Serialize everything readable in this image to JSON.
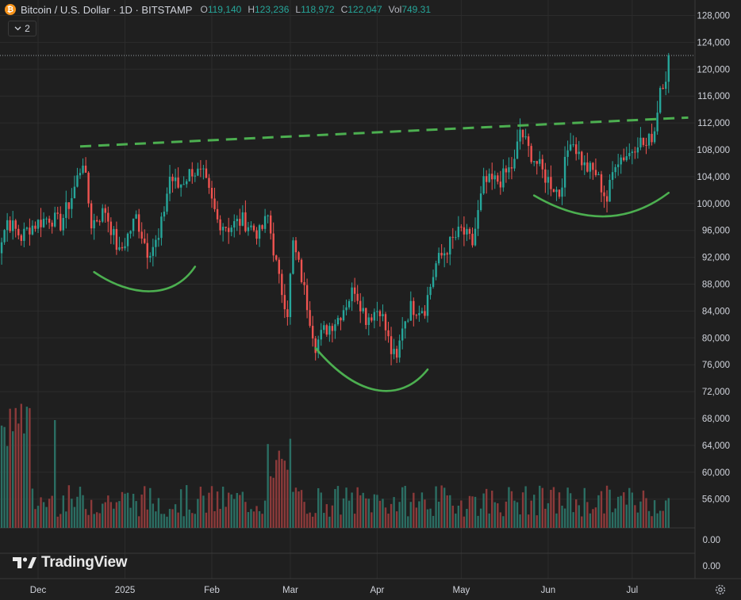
{
  "header": {
    "coin_glyph": "₿",
    "symbol": "Bitcoin / U.S. Dollar · 1D · BITSTAMP",
    "ohlc": [
      {
        "k": "O",
        "v": "119,140"
      },
      {
        "k": "H",
        "v": "123,236"
      },
      {
        "k": "L",
        "v": "118,972"
      },
      {
        "k": "C",
        "v": "122,047"
      },
      {
        "k": "Vol",
        "v": "749.31"
      }
    ]
  },
  "indicator_count": "2",
  "brand": "TradingView",
  "colors": {
    "up": "#26a69a",
    "down": "#ef5350",
    "vol_up": "#2b6e63",
    "vol_down": "#8b3a3a",
    "annotation": "#4caf50",
    "background": "#1f1f1f",
    "grid": "#2c2c2c",
    "axis_text": "#d1d4dc"
  },
  "chart_data": {
    "type": "candlestick",
    "x_axis": {
      "ticks": [
        {
          "date": "2024-12-01",
          "label": "Dec"
        },
        {
          "date": "2025-01-01",
          "label": "2025"
        },
        {
          "date": "2025-02-01",
          "label": "Feb"
        },
        {
          "date": "2025-03-01",
          "label": "Mar"
        },
        {
          "date": "2025-04-01",
          "label": "Apr"
        },
        {
          "date": "2025-05-01",
          "label": "May"
        },
        {
          "date": "2025-06-01",
          "label": "Jun"
        },
        {
          "date": "2025-07-01",
          "label": "Jul"
        }
      ]
    },
    "y_axis": {
      "range": [
        52000,
        130000
      ],
      "ticks": [
        "128,000",
        "124,000",
        "120,000",
        "116,000",
        "112,000",
        "108,000",
        "104,000",
        "100,000",
        "96,000",
        "92,000",
        "88,000",
        "84,000",
        "80,000",
        "76,000",
        "72,000",
        "68,000",
        "64,000",
        "60,000",
        "56,000"
      ],
      "tick_values": [
        128000,
        124000,
        120000,
        116000,
        112000,
        108000,
        104000,
        100000,
        96000,
        92000,
        88000,
        84000,
        80000,
        76000,
        72000,
        68000,
        64000,
        60000,
        56000
      ],
      "lower_pane_ticks": [
        "0.00",
        "0.00"
      ]
    },
    "last_price_line": 122047,
    "price_waypoints": [
      [
        "2024-11-15",
        91000
      ],
      [
        "2024-11-20",
        97500
      ],
      [
        "2024-11-25",
        95000
      ],
      [
        "2024-11-28",
        96500
      ],
      [
        "2024-12-05",
        98000
      ],
      [
        "2024-12-09",
        97000
      ],
      [
        "2024-12-13",
        101000
      ],
      [
        "2024-12-17",
        106500
      ],
      [
        "2024-12-20",
        97000
      ],
      [
        "2024-12-25",
        99000
      ],
      [
        "2024-12-30",
        92500
      ],
      [
        "2025-01-05",
        98000
      ],
      [
        "2025-01-09",
        93000
      ],
      [
        "2025-01-13",
        94500
      ],
      [
        "2025-01-17",
        104000
      ],
      [
        "2025-01-20",
        102500
      ],
      [
        "2025-01-25",
        105000
      ],
      [
        "2025-01-29",
        104000
      ],
      [
        "2025-02-03",
        97500
      ],
      [
        "2025-02-07",
        96500
      ],
      [
        "2025-02-12",
        97500
      ],
      [
        "2025-02-18",
        95500
      ],
      [
        "2025-02-21",
        98000
      ],
      [
        "2025-02-25",
        88500
      ],
      [
        "2025-02-28",
        84000
      ],
      [
        "2025-03-02",
        94000
      ],
      [
        "2025-03-05",
        89000
      ],
      [
        "2025-03-10",
        79000
      ],
      [
        "2025-03-13",
        81000
      ],
      [
        "2025-03-18",
        83000
      ],
      [
        "2025-03-24",
        87500
      ],
      [
        "2025-03-28",
        83000
      ],
      [
        "2025-04-02",
        84500
      ],
      [
        "2025-04-06",
        78000
      ],
      [
        "2025-04-08",
        76500
      ],
      [
        "2025-04-10",
        82000
      ],
      [
        "2025-04-13",
        84500
      ],
      [
        "2025-04-18",
        84500
      ],
      [
        "2025-04-22",
        91000
      ],
      [
        "2025-04-27",
        94000
      ],
      [
        "2025-05-01",
        96000
      ],
      [
        "2025-05-05",
        94000
      ],
      [
        "2025-05-09",
        103000
      ],
      [
        "2025-05-15",
        103500
      ],
      [
        "2025-05-20",
        106000
      ],
      [
        "2025-05-22",
        111000
      ],
      [
        "2025-05-25",
        108000
      ],
      [
        "2025-05-31",
        104000
      ],
      [
        "2025-06-05",
        101500
      ],
      [
        "2025-06-09",
        110000
      ],
      [
        "2025-06-14",
        105500
      ],
      [
        "2025-06-18",
        104500
      ],
      [
        "2025-06-22",
        100500
      ],
      [
        "2025-06-25",
        106500
      ],
      [
        "2025-06-30",
        107500
      ],
      [
        "2025-07-03",
        109500
      ],
      [
        "2025-07-06",
        108500
      ],
      [
        "2025-07-09",
        111000
      ],
      [
        "2025-07-11",
        117500
      ],
      [
        "2025-07-13",
        119100
      ],
      [
        "2025-07-14",
        122047
      ]
    ],
    "annotations": {
      "neckline": {
        "from": [
          "2024-12-16",
          108500
        ],
        "to": [
          "2025-07-21",
          112800
        ],
        "style": "dashed"
      },
      "arcs": [
        [
          [
            "2024-12-21",
            89800
          ],
          [
            "2025-01-03",
            86100
          ],
          [
            "2025-01-18",
            85600
          ],
          [
            "2025-01-26",
            90600
          ]
        ],
        [
          [
            "2025-03-10",
            78500
          ],
          [
            "2025-03-26",
            70600
          ],
          [
            "2025-04-10",
            70600
          ],
          [
            "2025-04-19",
            75300
          ]
        ],
        [
          [
            "2025-05-27",
            101200
          ],
          [
            "2025-06-14",
            96800
          ],
          [
            "2025-06-30",
            97200
          ],
          [
            "2025-07-14",
            101600
          ]
        ]
      ]
    }
  }
}
